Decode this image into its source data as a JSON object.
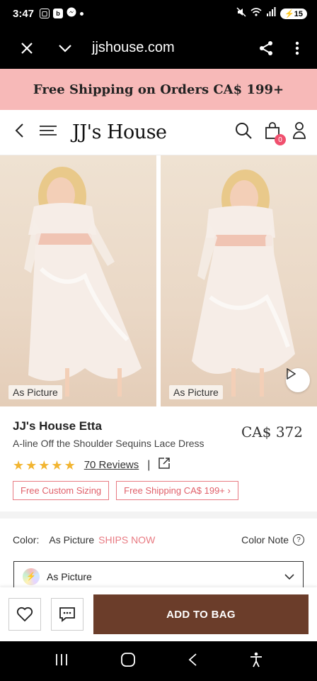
{
  "status": {
    "time": "3:47",
    "app_icon_b": "b",
    "battery": "15"
  },
  "browser": {
    "url": "jjshouse.com"
  },
  "promo": {
    "text": "Free Shipping on Orders CA$ 199+"
  },
  "header": {
    "logo": "JJ's House",
    "bag_count": "0"
  },
  "gallery": {
    "label_left": "As Picture",
    "label_right": "As Picture"
  },
  "product": {
    "name": "JJ's House Etta",
    "description": "A-line Off the Shoulder Sequins Lace Dress",
    "price": "CA$ 372",
    "rating_stars": 5,
    "reviews": "70 Reviews",
    "tag_custom": "Free Custom Sizing",
    "tag_shipping": "Free Shipping CA$ 199+"
  },
  "color": {
    "label": "Color:",
    "value": "As Picture",
    "ships": "SHIPS NOW",
    "note": "Color Note",
    "selected": "As Picture"
  },
  "actions": {
    "add_to_bag": "ADD TO BAG"
  },
  "colors": {
    "promo_bg": "#f7b9b8",
    "accent_pink": "#e87a82",
    "button_brown": "#6b3d2a",
    "star": "#f2b531"
  }
}
